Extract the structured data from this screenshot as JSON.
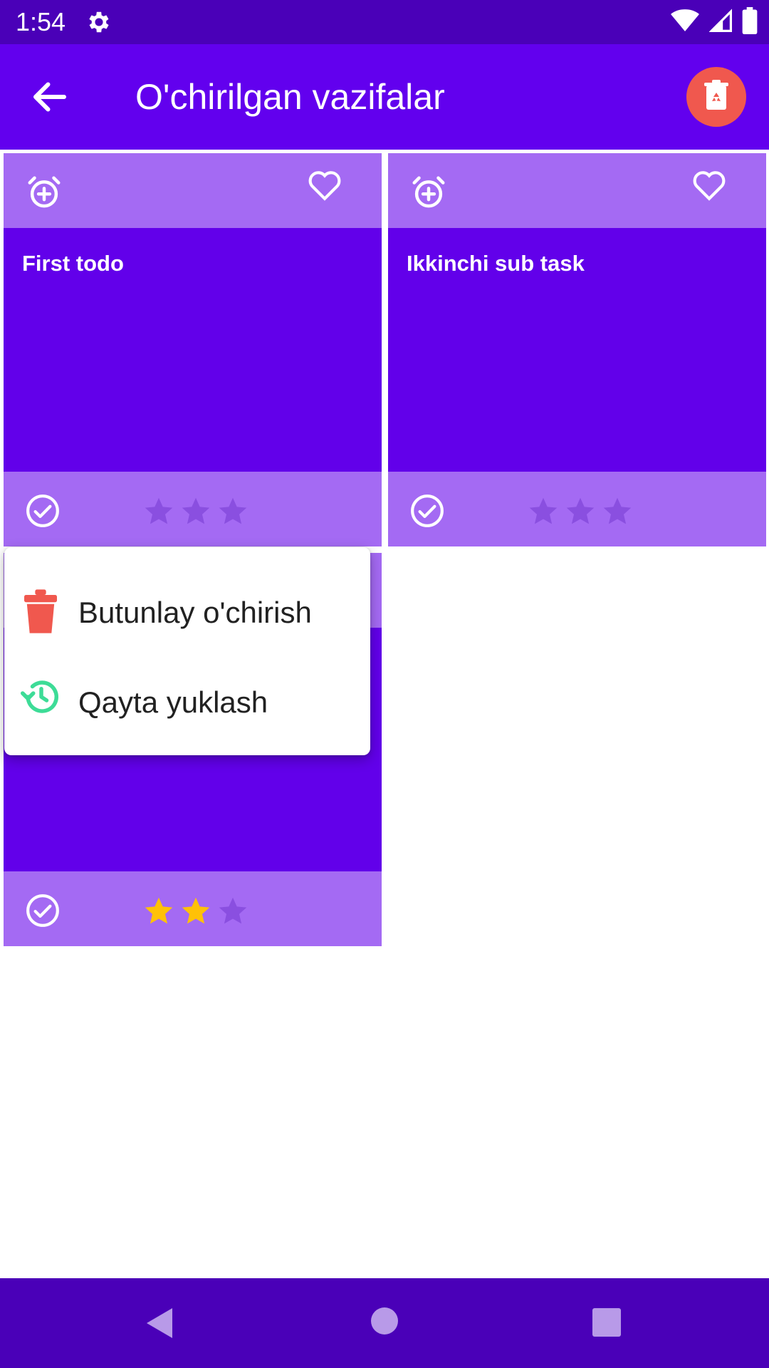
{
  "status_bar": {
    "time": "1:54",
    "icons": [
      "gear-icon",
      "wifi-icon",
      "signal-icon",
      "battery-icon"
    ]
  },
  "app_bar": {
    "title": "O'chirilgan vazifalar",
    "back_icon": "arrow-left-icon",
    "action_icon": "recycle-bin-icon"
  },
  "cards": [
    {
      "title": "First todo",
      "rating": 0,
      "max_rating": 3
    },
    {
      "title": "Ikkinchi sub task",
      "rating": 0,
      "max_rating": 3
    },
    {
      "title": "",
      "rating": 2,
      "max_rating": 3
    }
  ],
  "context_menu": {
    "items": [
      {
        "label": "Butunlay o'chirish",
        "icon": "trash-icon"
      },
      {
        "label": "Qayta yuklash",
        "icon": "restore-icon"
      }
    ]
  },
  "colors": {
    "status_bar": "#4a00b8",
    "app_bar": "#6200ee",
    "card_body": "#6200ea",
    "card_band": "#a46af3",
    "star_on": "#ffc107",
    "star_off": "#8a4fe0",
    "delete_red": "#f0584e",
    "restore_green": "#3ddc97"
  }
}
